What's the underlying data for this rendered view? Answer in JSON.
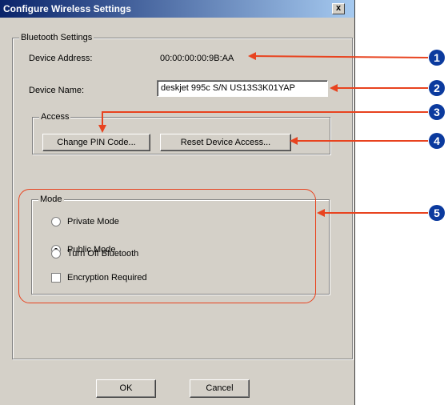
{
  "window": {
    "title": "Configure Wireless Settings",
    "close_label": "x"
  },
  "bluetooth_settings": {
    "legend": "Bluetooth Settings",
    "device_address_label": "Device Address:",
    "device_address_value": "00:00:00:00:9B:AA",
    "device_name_label": "Device Name:",
    "device_name_value": "deskjet 995c S/N US13S3K01YAP"
  },
  "access": {
    "legend": "Access",
    "change_pin_label": "Change PIN Code...",
    "reset_access_label": "Reset Device Access..."
  },
  "mode": {
    "legend": "Mode",
    "options": [
      {
        "label": "Private Mode",
        "selected": false
      },
      {
        "label": "Public Mode",
        "selected": true
      },
      {
        "label": "Turn Off Bluetooth",
        "selected": false
      }
    ],
    "encryption_label": "Encryption Required",
    "encryption_checked": false
  },
  "footer": {
    "ok_label": "OK",
    "cancel_label": "Cancel"
  },
  "callouts": [
    "1",
    "2",
    "3",
    "4",
    "5"
  ],
  "colors": {
    "arrow": "#e8431f",
    "callout_bg": "#0b3a9e",
    "title_start": "#0a246a",
    "title_end": "#a6caf0"
  }
}
